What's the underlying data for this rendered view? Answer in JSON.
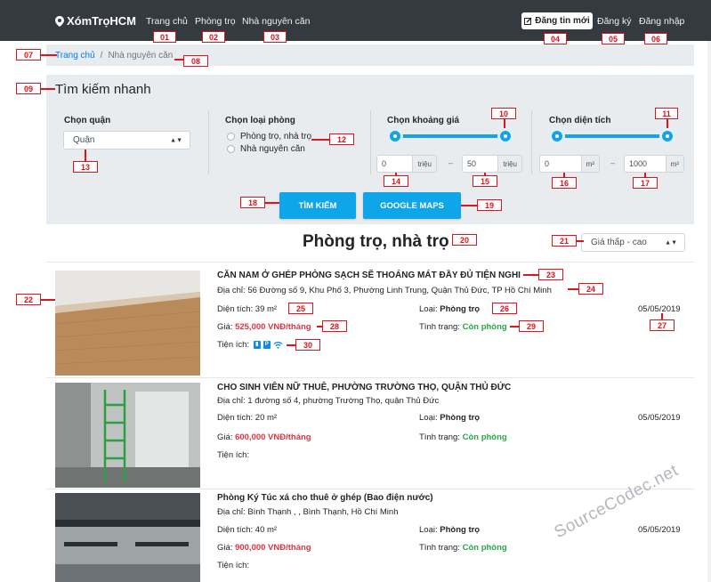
{
  "navbar": {
    "brand": "XómTrọHCM",
    "links": [
      "Trang chủ",
      "Phòng trọ",
      "Nhà nguyên căn"
    ],
    "post_button": "Đăng tin mới",
    "register": "Đăng ký",
    "login": "Đăng nhập"
  },
  "breadcrumb": {
    "home": "Trang chủ",
    "separator": "/",
    "current": "Nhà nguyên căn"
  },
  "search": {
    "title": "Tìm kiếm nhanh",
    "district_label": "Chọn quận",
    "district_value": "Quận",
    "room_type_label": "Chọn loại phòng",
    "room_type_options": [
      "Phòng trọ, nhà trọ",
      "Nhà nguyên căn"
    ],
    "price_label": "Chọn khoảng giá",
    "price_min": "0",
    "price_max": "50",
    "price_unit": "triệu",
    "area_label": "Chọn diện tích",
    "area_min": "0",
    "area_max": "1000",
    "area_unit": "m²",
    "range_dash": "–",
    "search_button": "TÌM KIẾM",
    "maps_button": "GOOGLE MAPS"
  },
  "results": {
    "title": "Phòng trọ, nhà trọ",
    "sort_value": "Giá thấp - cao"
  },
  "labels": {
    "area": "Diện tích:",
    "price": "Giá:",
    "amenities": "Tiện ích:",
    "type": "Loại:",
    "status": "Tình trạng:"
  },
  "listings": [
    {
      "title": "CĂN NAM Ở GHÉP PHÒNG SẠCH SẼ THOÁNG MÁT ĐẦY ĐỦ TIỆN NGHI",
      "address": "Địa chỉ: 56 Đường số 9, Khu Phố 3, Phường Linh Trung, Quận Thủ Đức, TP Hồ Chí Minh",
      "area": "39 m²",
      "price": "525,000 VNĐ/tháng",
      "type": "Phòng trọ",
      "status": "Còn phòng",
      "date": "05/05/2019",
      "amenity_icons": [
        "toilet-icon",
        "parking-icon",
        "wifi-icon"
      ]
    },
    {
      "title": "CHO SINH VIÊN NỮ THUÊ, PHƯỜNG TRƯỜNG THỌ, QUẬN THỦ ĐỨC",
      "address": "Địa chỉ: 1 đường số 4, phường Trường Thọ, quận Thủ Đức",
      "area": "20 m²",
      "price": "600,000 VNĐ/tháng",
      "type": "Phòng trọ",
      "status": "Còn phòng",
      "date": "05/05/2019"
    },
    {
      "title": "Phòng Ký Túc xá cho thuê ở ghép (Bao điện nước)",
      "address": "Địa chỉ: Bình Thạnh , , Bình Thạnh, Hồ Chí Minh",
      "area": "40 m²",
      "price": "900,000 VNĐ/tháng",
      "type": "Phòng trọ",
      "status": "Còn phòng",
      "date": "05/05/2019"
    }
  ],
  "annotations": [
    "01",
    "02",
    "03",
    "04",
    "05",
    "06",
    "07",
    "08",
    "09",
    "10",
    "11",
    "12",
    "13",
    "14",
    "15",
    "16",
    "17",
    "18",
    "19",
    "20",
    "21",
    "22",
    "23",
    "24",
    "25",
    "26",
    "27",
    "28",
    "29",
    "30"
  ],
  "watermark": "SourceCodec.net",
  "colors": {
    "navbar": "#343a40",
    "accent": "#17a2e6",
    "price": "#dc3545",
    "status": "#28a745",
    "annotation": "#e0131c"
  }
}
